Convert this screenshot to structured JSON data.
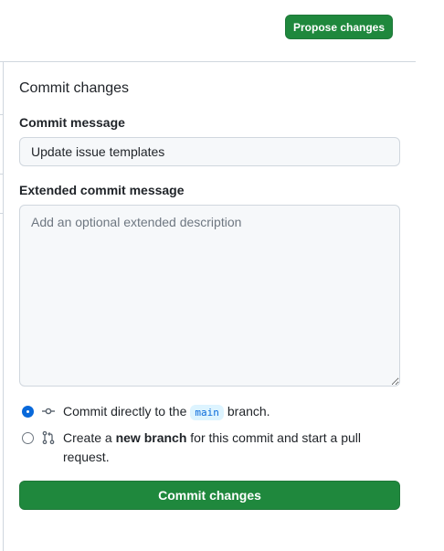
{
  "header": {
    "propose_label": "Propose changes"
  },
  "panel": {
    "title": "Commit changes",
    "commit_message_label": "Commit message",
    "commit_message_value": "Update issue templates",
    "extended_label": "Extended commit message",
    "extended_placeholder": "Add an optional extended description",
    "options": {
      "direct": {
        "prefix": "Commit directly to the",
        "branch": "main",
        "suffix": "branch.",
        "selected": true,
        "icon": "git-commit-icon"
      },
      "new_branch": {
        "prefix": "Create a",
        "bold": "new branch",
        "suffix": "for this commit and start a pull request.",
        "selected": false,
        "icon": "git-pull-request-icon"
      }
    },
    "submit_label": "Commit changes"
  },
  "colors": {
    "primary_green": "#1f883d",
    "accent_blue": "#0969da",
    "border": "#d0d7de",
    "input_bg": "#f6f8fa"
  }
}
